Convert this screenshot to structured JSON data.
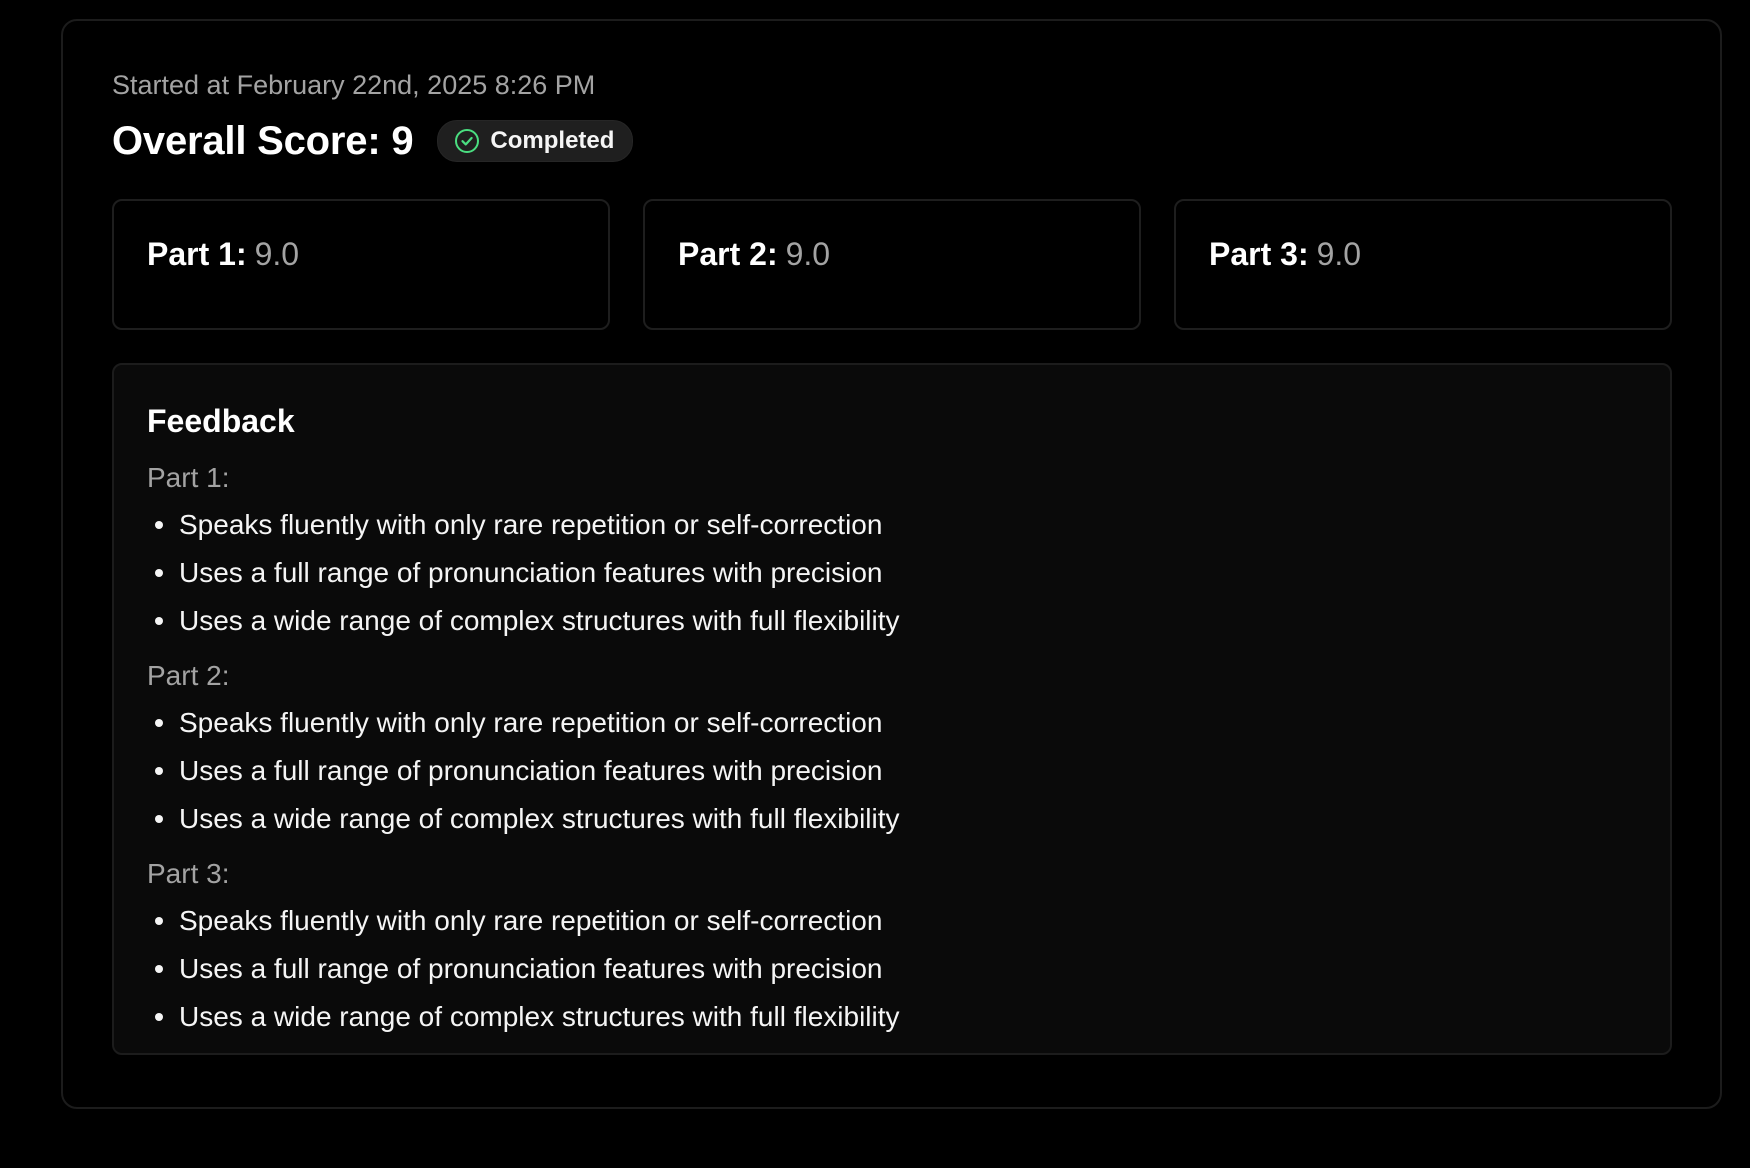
{
  "session": {
    "started_text": "Started at February 22nd, 2025 8:26 PM",
    "overall_score_text": "Overall Score: 9",
    "status": {
      "label": "Completed",
      "icon": "check-circle-icon",
      "icon_color": "#4ade80"
    }
  },
  "parts": [
    {
      "label": "Part 1:",
      "score": "9.0"
    },
    {
      "label": "Part 2:",
      "score": "9.0"
    },
    {
      "label": "Part 3:",
      "score": "9.0"
    }
  ],
  "feedback": {
    "title": "Feedback",
    "sections": [
      {
        "label": "Part 1:",
        "items": [
          "Speaks fluently with only rare repetition or self-correction",
          "Uses a full range of pronunciation features with precision",
          "Uses a wide range of complex structures with full flexibility"
        ]
      },
      {
        "label": "Part 2:",
        "items": [
          "Speaks fluently with only rare repetition or self-correction",
          "Uses a full range of pronunciation features with precision",
          "Uses a wide range of complex structures with full flexibility"
        ]
      },
      {
        "label": "Part 3:",
        "items": [
          "Speaks fluently with only rare repetition or self-correction",
          "Uses a full range of pronunciation features with precision",
          "Uses a wide range of complex structures with full flexibility"
        ]
      }
    ]
  }
}
